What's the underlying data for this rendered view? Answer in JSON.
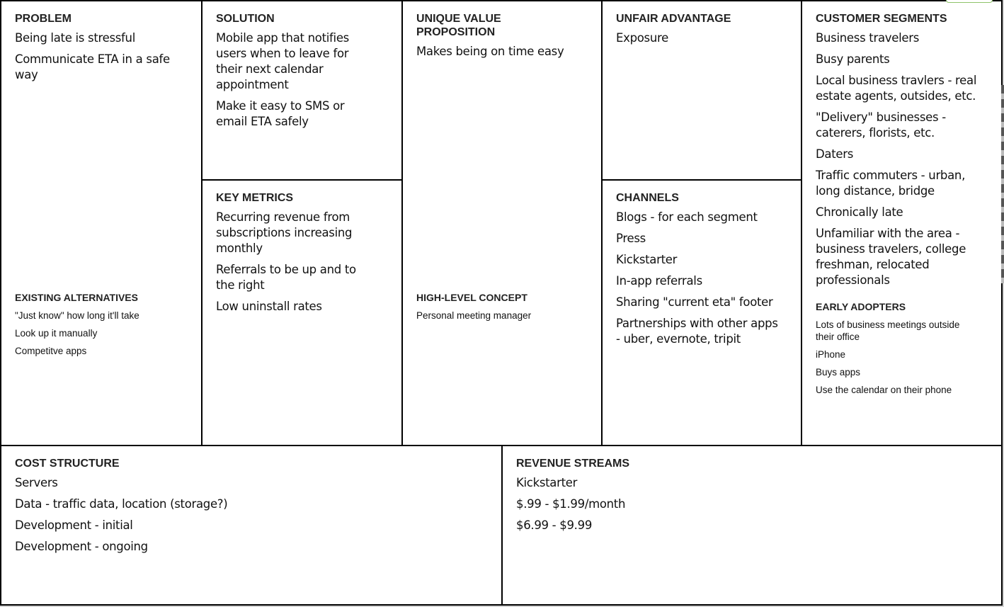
{
  "canvas": {
    "problem": {
      "title": "PROBLEM",
      "items": [
        "Being late is stressful",
        "Communicate ETA in a safe way"
      ],
      "existing_alternatives": {
        "title": "EXISTING ALTERNATIVES",
        "items": [
          "\"Just know\" how long it'll take",
          "Look up it manually",
          "Competitve apps"
        ]
      }
    },
    "solution": {
      "title": "SOLUTION",
      "items": [
        "Mobile app that notifies users when to leave for their next calendar appointment",
        "Make it easy to SMS or email ETA safely"
      ]
    },
    "key_metrics": {
      "title": "KEY METRICS",
      "items": [
        "Recurring revenue from subscriptions increasing monthly",
        "Referrals to be up and to the right",
        "Low uninstall rates"
      ]
    },
    "unique_value_proposition": {
      "title": "UNIQUE VALUE PROPOSITION",
      "items": [
        "Makes being on time easy"
      ],
      "high_level_concept": {
        "title": "HIGH-LEVEL CONCEPT",
        "items": [
          "Personal meeting manager"
        ]
      }
    },
    "unfair_advantage": {
      "title": "UNFAIR ADVANTAGE",
      "items": [
        "Exposure"
      ]
    },
    "channels": {
      "title": "CHANNELS",
      "items": [
        "Blogs - for each segment",
        "Press",
        "Kickstarter",
        "In-app referrals",
        "Sharing \"current eta\" footer",
        "Partnerships with other apps - uber, evernote, tripit"
      ]
    },
    "customer_segments": {
      "title": "CUSTOMER SEGMENTS",
      "items": [
        "Business travelers",
        "Busy parents",
        "Local business travlers - real estate agents, outsides, etc.",
        "\"Delivery\" businesses - caterers, florists, etc.",
        "Daters",
        "Traffic commuters - urban, long distance, bridge",
        "Chronically late",
        "Unfamiliar with the area - business travelers, college freshman, relocated professionals"
      ],
      "early_adopters": {
        "title": "EARLY ADOPTERS",
        "items": [
          "Lots of business meetings outside their office",
          "iPhone",
          "Buys apps",
          "Use the calendar on their phone"
        ]
      }
    },
    "cost_structure": {
      "title": "COST STRUCTURE",
      "items": [
        "Servers",
        "Data - traffic data, location (storage?)",
        "Development - initial",
        "Development - ongoing"
      ]
    },
    "revenue_streams": {
      "title": "REVENUE STREAMS",
      "items": [
        "Kickstarter",
        "$.99 - $1.99/month",
        "$6.99 - $9.99"
      ]
    }
  }
}
